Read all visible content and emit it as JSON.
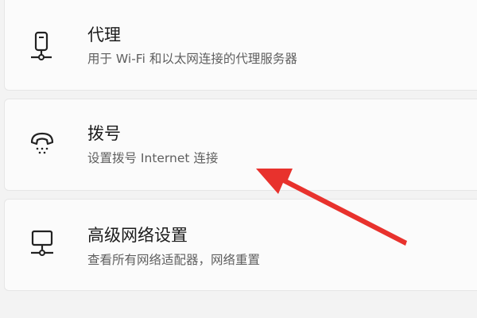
{
  "settings": {
    "proxy": {
      "title": "代理",
      "subtitle": "用于 Wi-Fi 和以太网连接的代理服务器",
      "icon": "proxy-device-icon"
    },
    "dialup": {
      "title": "拨号",
      "subtitle": "设置拨号 Internet 连接",
      "icon": "dialup-phone-icon"
    },
    "advanced": {
      "title": "高级网络设置",
      "subtitle": "查看所有网络适配器，网络重置",
      "icon": "network-monitor-icon"
    }
  },
  "annotation": {
    "icon": "red-arrow",
    "color": "#e8322d"
  }
}
